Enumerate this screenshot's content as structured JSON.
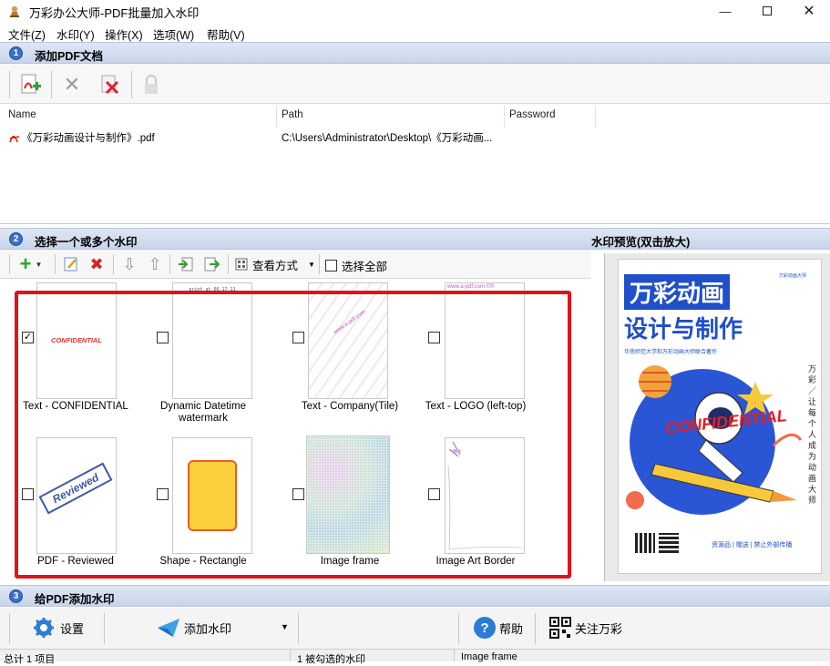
{
  "window": {
    "title": "万彩办公大师-PDF批量加入水印"
  },
  "menu": [
    "文件(Z)",
    "水印(Y)",
    "操作(X)",
    "选项(W)",
    "帮助(V)"
  ],
  "sections": {
    "s1": {
      "num": "1",
      "title": "添加PDF文档"
    },
    "s2": {
      "num": "2",
      "title": "选择一个或多个水印"
    },
    "s3": {
      "num": "3",
      "title": "给PDF添加水印"
    }
  },
  "filelist": {
    "columns": [
      "Name",
      "Path",
      "Password"
    ],
    "rows": [
      {
        "name": "《万彩动画设计与制作》.pdf",
        "path": "C:\\Users\\Administrator\\Desktop\\《万彩动画...",
        "password": ""
      }
    ]
  },
  "wm_toolbar": {
    "view_mode": "查看方式",
    "select_all": "选择全部"
  },
  "watermarks": [
    {
      "label": "Text - CONFIDENTIAL",
      "checked": true,
      "preview_text": "CONFIDENTIAL"
    },
    {
      "label": "Dynamic Datetime watermark",
      "checked": false,
      "preview_text": "print at 06-17-11"
    },
    {
      "label": "Text - Company(Tile)",
      "checked": false,
      "preview_text": "www.a-pdf.com"
    },
    {
      "label": "Text - LOGO (left-top)",
      "checked": false,
      "preview_text": "www.a-pdf.com ©®"
    },
    {
      "label": "PDF - Reviewed",
      "checked": false,
      "preview_text": "Reviewed"
    },
    {
      "label": "Shape - Rectangle",
      "checked": false,
      "preview_text": ""
    },
    {
      "label": "Image frame",
      "checked": false,
      "preview_text": ""
    },
    {
      "label": "Image Art Border",
      "checked": false,
      "preview_text": ""
    }
  ],
  "preview": {
    "label": "水印预览(双击放大)",
    "line1": "万彩动画",
    "line2": "设计与制作",
    "subtitle": "华南师范大学和万彩动画大师联合著作",
    "brand": "万彩动画大师",
    "vertical": "万彩／让每个人成为动画大师",
    "watermark": "CONFIDENTIAL",
    "footer": "资源品 | 赠送 | 禁止外部传播"
  },
  "bottom": {
    "settings": "设置",
    "add_watermark": "添加水印",
    "help": "帮助",
    "follow": "关注万彩"
  },
  "status": {
    "items": "总计 1 项目",
    "selected": "1 被勾选的水印",
    "current": "Image frame"
  }
}
